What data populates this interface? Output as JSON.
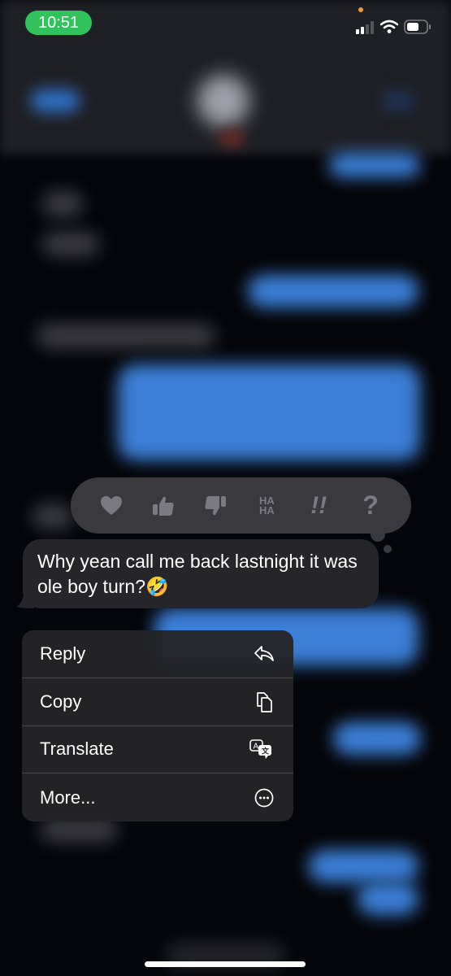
{
  "status_bar": {
    "time": "10:51",
    "time_pill_color": "#31c25b",
    "privacy_indicator_color": "#f29a2a",
    "signal_icon": "cellular-signal-icon",
    "wifi_icon": "wifi-icon",
    "battery_icon": "battery-icon"
  },
  "tapbacks": [
    {
      "name": "heart",
      "icon": "heart-icon"
    },
    {
      "name": "thumbs-up",
      "icon": "thumbs-up-icon"
    },
    {
      "name": "thumbs-down",
      "icon": "thumbs-down-icon"
    },
    {
      "name": "haha",
      "icon": "haha-icon",
      "text_top": "HA",
      "text_bottom": "HA"
    },
    {
      "name": "emphasize",
      "icon": "double-exclamation-icon",
      "text": "!!"
    },
    {
      "name": "question",
      "icon": "question-mark-icon",
      "text": "?"
    }
  ],
  "message": {
    "text": "Why yean call me back lastnight it was ole boy turn?🤣",
    "direction": "received"
  },
  "context_menu": {
    "items": [
      {
        "label": "Reply",
        "icon": "reply-arrow-icon"
      },
      {
        "label": "Copy",
        "icon": "copy-documents-icon"
      },
      {
        "label": "Translate",
        "icon": "translate-bubbles-icon"
      },
      {
        "label": "More...",
        "icon": "more-ellipsis-circle-icon"
      }
    ]
  },
  "colors": {
    "sent_bubble": "#3b7fd6",
    "received_bubble": "#26262a",
    "menu_background": "#242428",
    "tapback_background": "#3a3a3e"
  }
}
